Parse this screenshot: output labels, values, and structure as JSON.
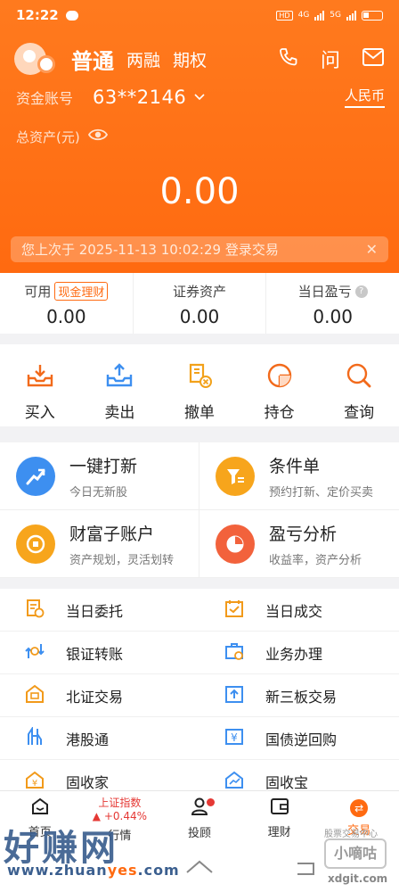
{
  "status_bar": {
    "time": "12:22",
    "network": "4G",
    "network2": "5G",
    "hd": "HD"
  },
  "header": {
    "account_type": "普通",
    "options": [
      "两融",
      "期权"
    ],
    "ask_label": "问",
    "account_label": "资金账号",
    "account_number": "63**2146",
    "currency": "人民币",
    "total_assets_label": "总资产(元)",
    "total_assets_value": "0.00",
    "last_login_notice": "您上次于 2025-11-13  10:02:29 登录交易",
    "close_label": "✕"
  },
  "summary": {
    "available": {
      "label": "可用",
      "tag": "现金理财",
      "value": "0.00"
    },
    "securities": {
      "label": "证券资产",
      "value": "0.00"
    },
    "daily_pl": {
      "label": "当日盈亏",
      "help": "?",
      "value": "0.00"
    }
  },
  "quick_actions": [
    {
      "label": "买入",
      "icon": "buy-icon"
    },
    {
      "label": "卖出",
      "icon": "sell-icon"
    },
    {
      "label": "撤单",
      "icon": "cancel-order-icon"
    },
    {
      "label": "持仓",
      "icon": "position-icon"
    },
    {
      "label": "查询",
      "icon": "search-icon"
    }
  ],
  "cards": [
    {
      "title": "一键打新",
      "subtitle": "今日无新股",
      "icon": "ipo-icon",
      "color": "#3d8ff0"
    },
    {
      "title": "条件单",
      "subtitle": "预约打新、定价买卖",
      "icon": "condition-icon",
      "color": "#f7a51c"
    },
    {
      "title": "财富子账户",
      "subtitle": "资产规划，灵活划转",
      "icon": "wealth-icon",
      "color": "#f7a51c"
    },
    {
      "title": "盈亏分析",
      "subtitle": "收益率，资产分析",
      "icon": "pl-analysis-icon",
      "color": "#f2623c"
    }
  ],
  "functions": [
    {
      "label": "当日委托",
      "icon": "daily-orders-icon",
      "color": "#f29a1a"
    },
    {
      "label": "当日成交",
      "icon": "daily-deals-icon",
      "color": "#f29a1a"
    },
    {
      "label": "银证转账",
      "icon": "bank-transfer-icon",
      "color": "#3d8ff0"
    },
    {
      "label": "业务办理",
      "icon": "business-icon",
      "color": "#3d8ff0"
    },
    {
      "label": "北证交易",
      "icon": "bse-trade-icon",
      "color": "#f29a1a"
    },
    {
      "label": "新三板交易",
      "icon": "neeq-trade-icon",
      "color": "#3d8ff0"
    },
    {
      "label": "港股通",
      "icon": "hk-connect-icon",
      "color": "#3d8ff0"
    },
    {
      "label": "国债逆回购",
      "icon": "reverse-repo-icon",
      "color": "#3d8ff0"
    },
    {
      "label": "固收家",
      "icon": "fixed-income-home-icon",
      "color": "#f29a1a"
    },
    {
      "label": "固收宝",
      "icon": "fixed-income-treasure-icon",
      "color": "#3d8ff0"
    }
  ],
  "bottom_nav": {
    "home": "首页",
    "market_index_name": "上证指数",
    "market_index_change": "+0.44%",
    "market": "行情",
    "advisor": "投顾",
    "finance": "理财",
    "trade": "交易"
  },
  "watermarks": {
    "left_title": "好赚网",
    "left_url_a": "www.zhuan",
    "left_url_b": "yes",
    "left_url_c": ".com",
    "right_top": "股票交易中心",
    "right_badge": "小嘀咕",
    "right_url": "xdgit.com"
  }
}
